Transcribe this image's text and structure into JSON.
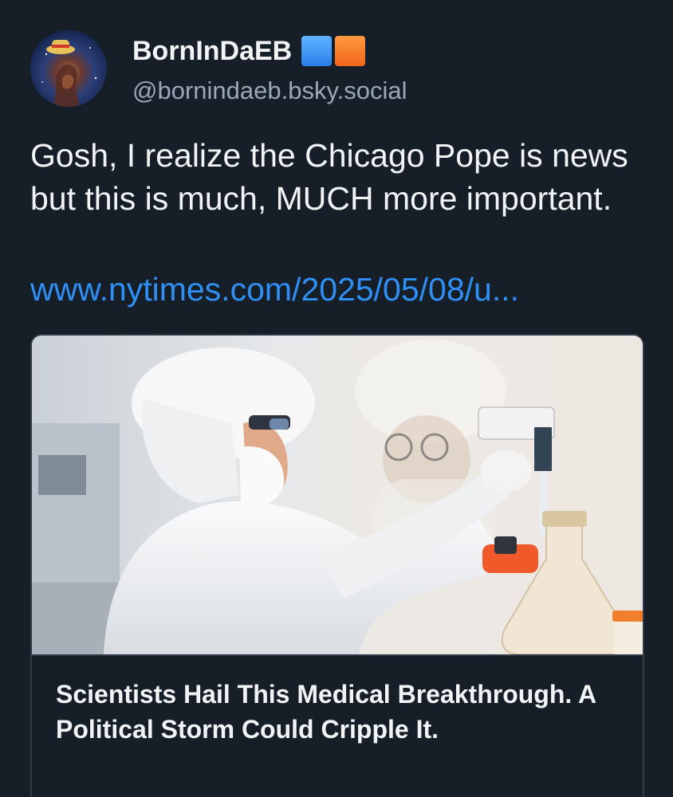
{
  "author": {
    "display_name": "BornInDaEB",
    "handle": "@bornindaeb.bsky.social",
    "flag_colors": [
      "#3a8ff0",
      "#f57a2a"
    ],
    "avatar_icon": "nebula-with-straw-hat-avatar"
  },
  "post": {
    "text": "Gosh, I realize the Chicago Pope is news but this is much, MUCH more important.",
    "link_text": "www.nytimes.com/2025/05/08/u..."
  },
  "link_card": {
    "image_icon": "lab-scientists-photo",
    "title": "Scientists Hail This Medical Breakthrough. A Political Storm Could Cripple It."
  },
  "colors": {
    "background": "#161e27",
    "text": "#f1f3f5",
    "handle": "#9aa8b8",
    "link": "#2f8ff5",
    "card_border": "#2e3a48"
  }
}
